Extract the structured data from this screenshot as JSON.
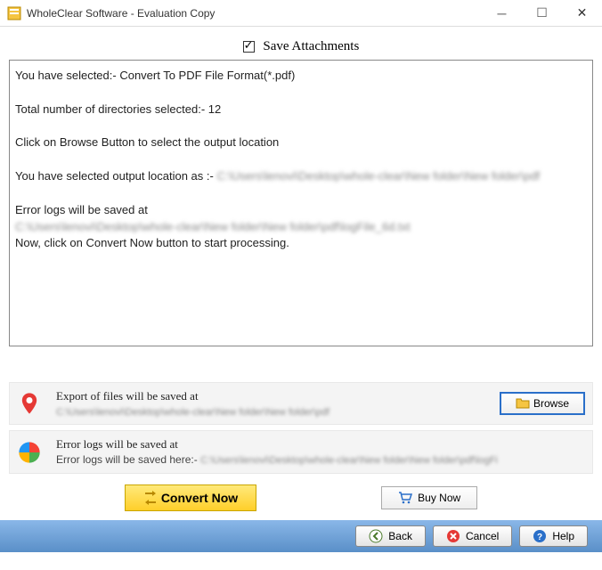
{
  "window": {
    "title": "WholeClear Software - Evaluation Copy"
  },
  "checkbox": {
    "label": "Save Attachments"
  },
  "log": {
    "l1": "You have selected:- Convert To PDF File Format(*.pdf)",
    "l2": "Total number of directories selected:- 12",
    "l3": "Click on Browse Button to select the output location",
    "l4a": "You have selected output location as :- ",
    "l4b": "C:\\Users\\lenovi\\Desktop\\whole-clear\\New folder\\New folder\\pdf",
    "l5": "Error logs will be saved at",
    "l6": "C:\\Users\\lenovi\\Desktop\\whole-clear\\New folder\\New folder\\pdf\\logFile_6d.txt",
    "l7": "Now, click on Convert Now button to start processing."
  },
  "export": {
    "label": "Export of files will be saved at",
    "path": "C:\\Users\\lenovi\\Desktop\\whole-clear\\New folder\\New folder\\pdf",
    "browse": "Browse"
  },
  "errors": {
    "label": "Error logs will be saved at",
    "prefix": "Error logs will be saved here:- ",
    "path": "C:\\Users\\lenovi\\Desktop\\whole-clear\\New folder\\New folder\\pdf\\logFi"
  },
  "buttons": {
    "convert": "Convert Now",
    "buy": "Buy Now",
    "back": "Back",
    "cancel": "Cancel",
    "help": "Help"
  }
}
